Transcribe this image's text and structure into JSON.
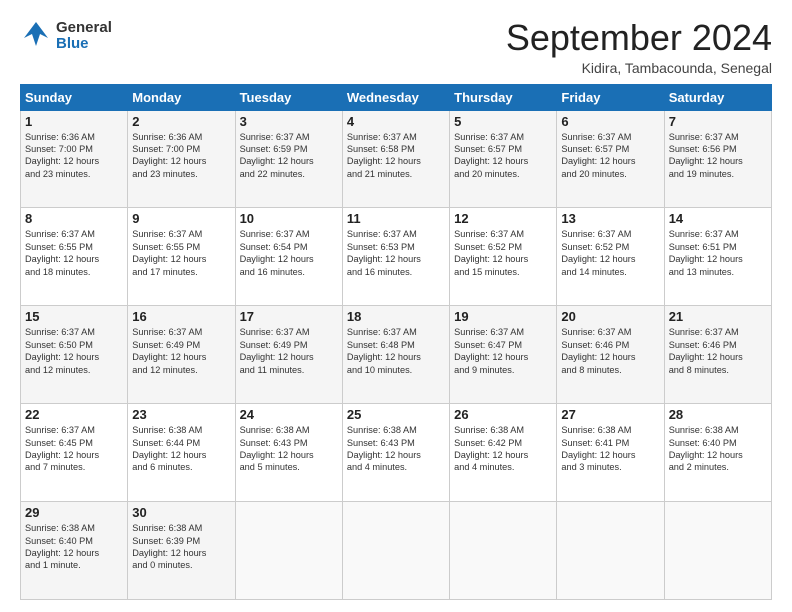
{
  "header": {
    "logo_general": "General",
    "logo_blue": "Blue",
    "month_title": "September 2024",
    "location": "Kidira, Tambacounda, Senegal"
  },
  "days_of_week": [
    "Sunday",
    "Monday",
    "Tuesday",
    "Wednesday",
    "Thursday",
    "Friday",
    "Saturday"
  ],
  "weeks": [
    [
      {
        "day": "1",
        "sunrise": "6:36 AM",
        "sunset": "7:00 PM",
        "daylight": "12 hours and 23 minutes."
      },
      {
        "day": "2",
        "sunrise": "6:36 AM",
        "sunset": "7:00 PM",
        "daylight": "12 hours and 23 minutes."
      },
      {
        "day": "3",
        "sunrise": "6:37 AM",
        "sunset": "6:59 PM",
        "daylight": "12 hours and 22 minutes."
      },
      {
        "day": "4",
        "sunrise": "6:37 AM",
        "sunset": "6:58 PM",
        "daylight": "12 hours and 21 minutes."
      },
      {
        "day": "5",
        "sunrise": "6:37 AM",
        "sunset": "6:57 PM",
        "daylight": "12 hours and 20 minutes."
      },
      {
        "day": "6",
        "sunrise": "6:37 AM",
        "sunset": "6:57 PM",
        "daylight": "12 hours and 20 minutes."
      },
      {
        "day": "7",
        "sunrise": "6:37 AM",
        "sunset": "6:56 PM",
        "daylight": "12 hours and 19 minutes."
      }
    ],
    [
      {
        "day": "8",
        "sunrise": "6:37 AM",
        "sunset": "6:55 PM",
        "daylight": "12 hours and 18 minutes."
      },
      {
        "day": "9",
        "sunrise": "6:37 AM",
        "sunset": "6:55 PM",
        "daylight": "12 hours and 17 minutes."
      },
      {
        "day": "10",
        "sunrise": "6:37 AM",
        "sunset": "6:54 PM",
        "daylight": "12 hours and 16 minutes."
      },
      {
        "day": "11",
        "sunrise": "6:37 AM",
        "sunset": "6:53 PM",
        "daylight": "12 hours and 16 minutes."
      },
      {
        "day": "12",
        "sunrise": "6:37 AM",
        "sunset": "6:52 PM",
        "daylight": "12 hours and 15 minutes."
      },
      {
        "day": "13",
        "sunrise": "6:37 AM",
        "sunset": "6:52 PM",
        "daylight": "12 hours and 14 minutes."
      },
      {
        "day": "14",
        "sunrise": "6:37 AM",
        "sunset": "6:51 PM",
        "daylight": "12 hours and 13 minutes."
      }
    ],
    [
      {
        "day": "15",
        "sunrise": "6:37 AM",
        "sunset": "6:50 PM",
        "daylight": "12 hours and 12 minutes."
      },
      {
        "day": "16",
        "sunrise": "6:37 AM",
        "sunset": "6:49 PM",
        "daylight": "12 hours and 12 minutes."
      },
      {
        "day": "17",
        "sunrise": "6:37 AM",
        "sunset": "6:49 PM",
        "daylight": "12 hours and 11 minutes."
      },
      {
        "day": "18",
        "sunrise": "6:37 AM",
        "sunset": "6:48 PM",
        "daylight": "12 hours and 10 minutes."
      },
      {
        "day": "19",
        "sunrise": "6:37 AM",
        "sunset": "6:47 PM",
        "daylight": "12 hours and 9 minutes."
      },
      {
        "day": "20",
        "sunrise": "6:37 AM",
        "sunset": "6:46 PM",
        "daylight": "12 hours and 8 minutes."
      },
      {
        "day": "21",
        "sunrise": "6:37 AM",
        "sunset": "6:46 PM",
        "daylight": "12 hours and 8 minutes."
      }
    ],
    [
      {
        "day": "22",
        "sunrise": "6:37 AM",
        "sunset": "6:45 PM",
        "daylight": "12 hours and 7 minutes."
      },
      {
        "day": "23",
        "sunrise": "6:38 AM",
        "sunset": "6:44 PM",
        "daylight": "12 hours and 6 minutes."
      },
      {
        "day": "24",
        "sunrise": "6:38 AM",
        "sunset": "6:43 PM",
        "daylight": "12 hours and 5 minutes."
      },
      {
        "day": "25",
        "sunrise": "6:38 AM",
        "sunset": "6:43 PM",
        "daylight": "12 hours and 4 minutes."
      },
      {
        "day": "26",
        "sunrise": "6:38 AM",
        "sunset": "6:42 PM",
        "daylight": "12 hours and 4 minutes."
      },
      {
        "day": "27",
        "sunrise": "6:38 AM",
        "sunset": "6:41 PM",
        "daylight": "12 hours and 3 minutes."
      },
      {
        "day": "28",
        "sunrise": "6:38 AM",
        "sunset": "6:40 PM",
        "daylight": "12 hours and 2 minutes."
      }
    ],
    [
      {
        "day": "29",
        "sunrise": "6:38 AM",
        "sunset": "6:40 PM",
        "daylight": "12 hours and 1 minute."
      },
      {
        "day": "30",
        "sunrise": "6:38 AM",
        "sunset": "6:39 PM",
        "daylight": "12 hours and 0 minutes."
      },
      null,
      null,
      null,
      null,
      null
    ]
  ],
  "labels": {
    "sunrise": "Sunrise:",
    "sunset": "Sunset:",
    "daylight": "Daylight:"
  }
}
